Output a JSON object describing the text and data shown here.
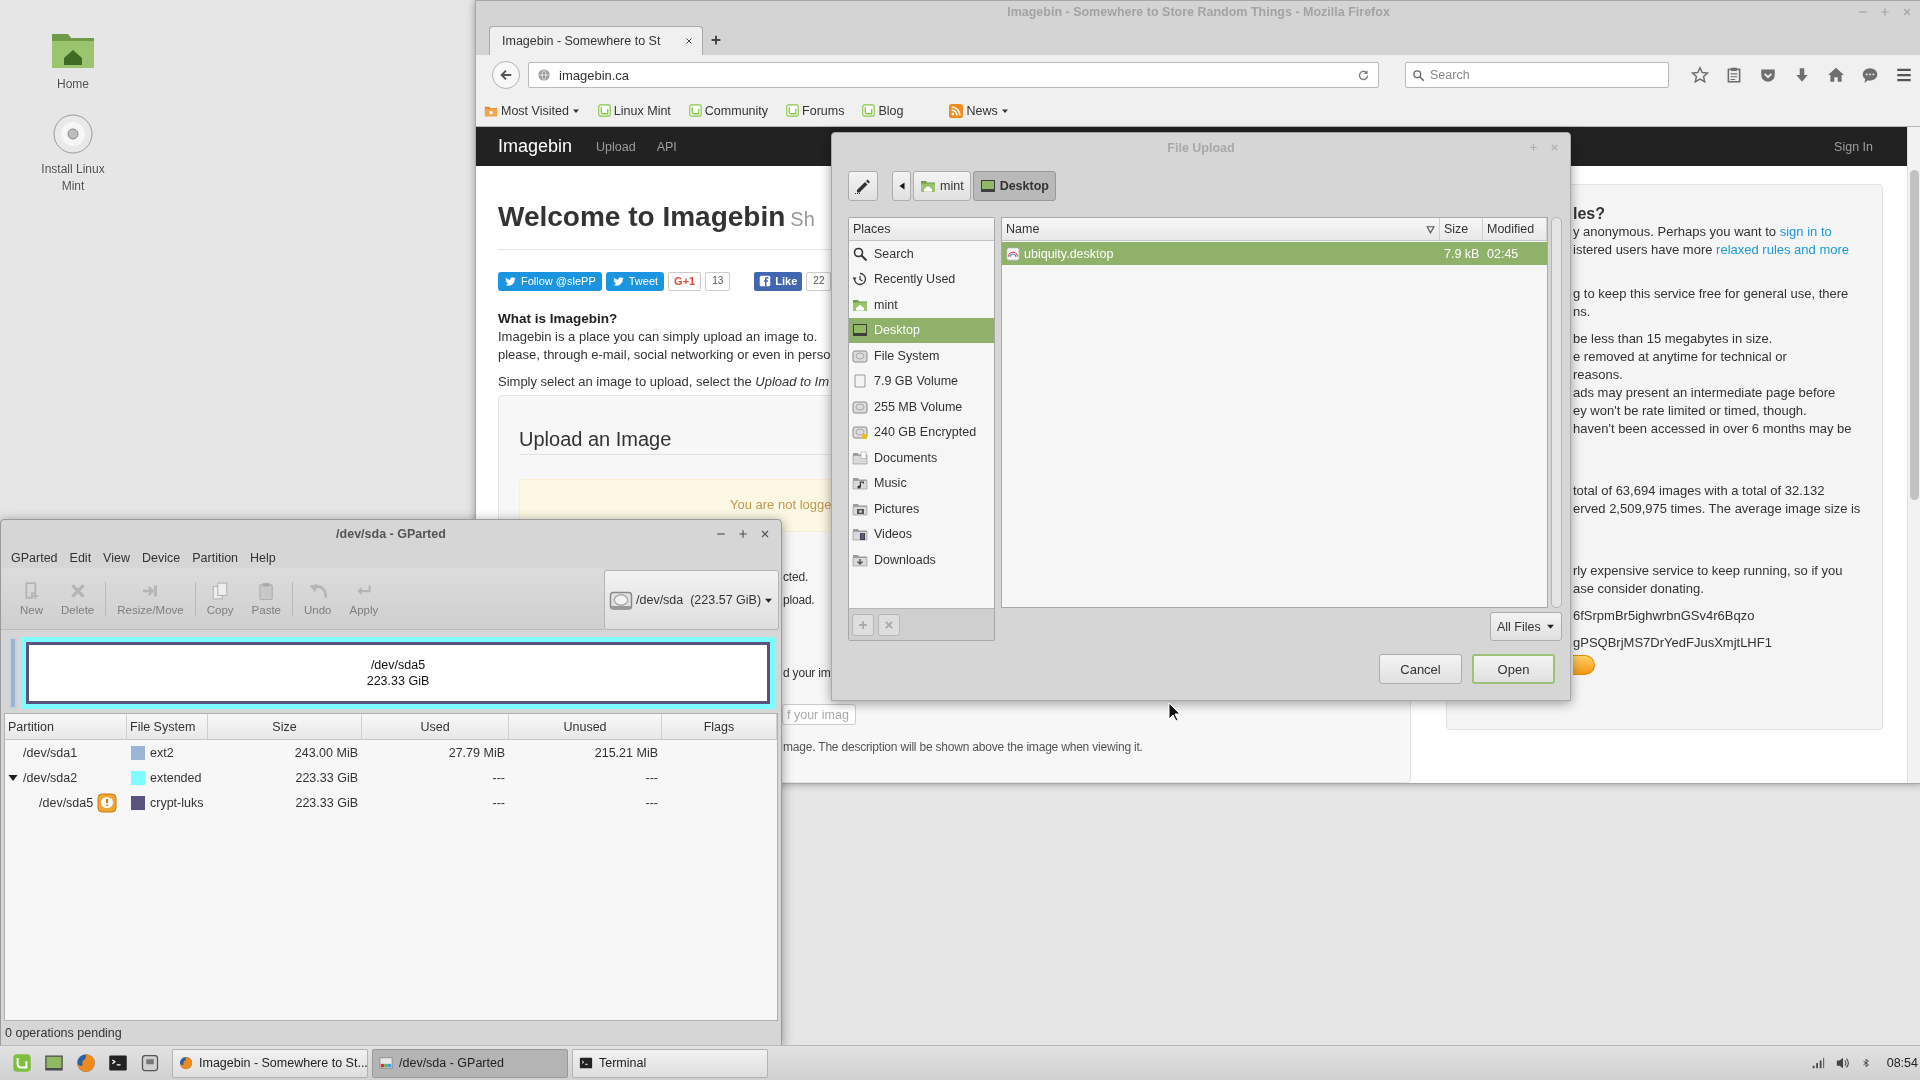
{
  "desktop": {
    "icons": [
      {
        "label": "Home",
        "kind": "home"
      },
      {
        "label": "Install Linux Mint",
        "kind": "disc"
      }
    ]
  },
  "firefox": {
    "title": "Imagebin - Somewhere to Store Random Things - Mozilla Firefox",
    "tabs": [
      {
        "label": "Imagebin - Somewhere to St",
        "selected": true
      }
    ],
    "url": "imagebin.ca",
    "search": {
      "placeholder": "Search"
    },
    "bookmarks": [
      {
        "label": "Most Visited",
        "kind": "folder",
        "menu": true
      },
      {
        "label": "Linux Mint",
        "kind": "site",
        "menu": false
      },
      {
        "label": "Community",
        "kind": "site",
        "menu": false
      },
      {
        "label": "Forums",
        "kind": "site",
        "menu": false
      },
      {
        "label": "Blog",
        "kind": "site",
        "menu": false
      },
      {
        "label": "News",
        "kind": "feed",
        "menu": true
      }
    ],
    "page": {
      "brand": "Imagebin",
      "nav_links": [
        "Upload",
        "API"
      ],
      "sign_in": "Sign In",
      "heading": "Welcome to Imagebin",
      "heading_small": "Sh",
      "social": [
        {
          "label": "Follow @slePP",
          "kind": "twitter"
        },
        {
          "label": "Tweet",
          "kind": "twitter"
        },
        {
          "label": "G+1",
          "kind": "gplus"
        },
        {
          "label": "13",
          "kind": "count"
        },
        {
          "label": "Like",
          "kind": "facebook"
        },
        {
          "label": "22",
          "kind": "count"
        }
      ],
      "intro_title": "What is Imagebin?",
      "intro": [
        "Imagebin is a place you can simply upload an image to.",
        "please, through e-mail, social networking or even in perso"
      ],
      "instruction": "Simply select an image to upload, select the *Upload to Im*",
      "upload": {
        "title": "Upload an Image",
        "alert": "You are not logge",
        "notes": [
          "cted.",
          "pload."
        ],
        "label": "d your im",
        "description": {
          "placeholder": "f your imag"
        },
        "help": "mage. The description will be shown above the image when viewing it."
      },
      "sidebar": [
        {
          "kind": "title",
          "lines": [
            [
              {
                "text": "les?",
                "link": false
              }
            ]
          ]
        },
        {
          "kind": "para",
          "lines": [
            [
              {
                "text": "y anonymous. Perhaps you want to ",
                "link": false
              },
              {
                "text": "sign in to",
                "link": true
              }
            ],
            [
              {
                "text": "istered users have more ",
                "link": false
              },
              {
                "text": "relaxed rules and more",
                "link": true
              }
            ]
          ]
        },
        {
          "kind": "para",
          "lines": [
            [
              {
                "text": "g to keep this service free for general use, there",
                "link": false
              }
            ],
            [
              {
                "text": "ns.",
                "link": false
              }
            ]
          ]
        },
        {
          "kind": "list",
          "lines": [
            [
              {
                "text": "be less than 15 megabytes in size.",
                "link": false
              }
            ],
            [
              {
                "text": "e removed at anytime for technical or",
                "link": false
              }
            ],
            [
              {
                "text": "reasons.",
                "link": false
              }
            ],
            [
              {
                "text": "ads may present an intermediate page before",
                "link": false
              }
            ],
            [
              {
                "text": "ey won't be rate limited or timed, though.",
                "link": false
              }
            ],
            [
              {
                "text": "haven't been accessed in over 6 months may be",
                "link": false
              }
            ]
          ]
        },
        {
          "kind": "section",
          "lines": [
            [
              {
                "text": "total of 63,694 images with a total of 32.132",
                "link": false
              }
            ],
            [
              {
                "text": "erved 2,509,975 times. The average image size is",
                "link": false
              }
            ]
          ]
        },
        {
          "kind": "section",
          "lines": [
            [
              {
                "text": "rly expensive service to keep running, so if you",
                "link": false
              }
            ],
            [
              {
                "text": "ase consider donating.",
                "link": false
              }
            ]
          ]
        },
        {
          "kind": "address",
          "lines": [
            [
              {
                "text": "6fSrpmBr5ighwrbnGSv4r6Bqzo",
                "link": false
              }
            ]
          ]
        },
        {
          "kind": "address",
          "lines": [
            [
              {
                "text": "gPSQBrjMS7DrYedFJusXmjtLHF1",
                "link": false
              }
            ]
          ]
        },
        {
          "kind": "donate"
        }
      ]
    }
  },
  "file_dialog": {
    "title": "File Upload",
    "path": [
      {
        "label": "mint",
        "kind": "home",
        "selected": false
      },
      {
        "label": "Desktop",
        "kind": "desktop",
        "selected": true
      }
    ],
    "places_title": "Places",
    "places": [
      {
        "label": "Search",
        "kind": "search",
        "selected": false
      },
      {
        "label": "Recently Used",
        "kind": "recent",
        "selected": false
      },
      {
        "label": "mint",
        "kind": "home",
        "selected": false
      },
      {
        "label": "Desktop",
        "kind": "desktop",
        "selected": true
      },
      {
        "label": "File System",
        "kind": "drive",
        "selected": false
      },
      {
        "label": "7.9 GB Volume",
        "kind": "volume",
        "selected": false
      },
      {
        "label": "255 MB Volume",
        "kind": "drive",
        "selected": false
      },
      {
        "label": "240 GB Encrypted",
        "kind": "encrypted",
        "selected": false
      },
      {
        "label": "Documents",
        "kind": "documents",
        "selected": false
      },
      {
        "label": "Music",
        "kind": "music",
        "selected": false
      },
      {
        "label": "Pictures",
        "kind": "pictures",
        "selected": false
      },
      {
        "label": "Videos",
        "kind": "videos",
        "selected": false
      },
      {
        "label": "Downloads",
        "kind": "downloads",
        "selected": false
      }
    ],
    "columns": [
      {
        "label": "Name",
        "sorted": true
      },
      {
        "label": "Size",
        "sorted": false
      },
      {
        "label": "Modified",
        "sorted": false
      }
    ],
    "files": [
      {
        "name": "ubiquity.desktop",
        "size": "7.9 kB",
        "modified": "02:45",
        "selected": true
      }
    ],
    "filter": "All Files",
    "buttons": [
      {
        "label": "Cancel",
        "default": false
      },
      {
        "label": "Open",
        "default": true
      }
    ]
  },
  "gparted": {
    "title": "/dev/sda - GParted",
    "menu": [
      "GParted",
      "Edit",
      "View",
      "Device",
      "Partition",
      "Help"
    ],
    "tools": [
      {
        "label": "New",
        "kind": "new",
        "disabled": true
      },
      {
        "label": "Delete",
        "kind": "delete",
        "disabled": true
      },
      {
        "kind": "separator"
      },
      {
        "label": "Resize/Move",
        "kind": "resize",
        "disabled": true
      },
      {
        "kind": "separator"
      },
      {
        "label": "Copy",
        "kind": "copy",
        "disabled": true
      },
      {
        "label": "Paste",
        "kind": "paste",
        "disabled": true
      },
      {
        "kind": "separator"
      },
      {
        "label": "Undo",
        "kind": "undo",
        "disabled": true
      },
      {
        "label": "Apply",
        "kind": "apply",
        "disabled": true
      }
    ],
    "device": {
      "label": "/dev/sda",
      "size": "(223.57 GiB)"
    },
    "map": {
      "label": "/dev/sda5",
      "size": "223.33 GiB"
    },
    "columns": [
      "Partition",
      "File System",
      "Size",
      "Used",
      "Unused",
      "Flags"
    ],
    "partitions": [
      {
        "name": "/dev/sda1",
        "fs": "ext2",
        "color": "#9db5d4",
        "size": "243.00 MiB",
        "used": "27.79 MiB",
        "unused": "215.21 MiB",
        "expanded": false,
        "warning": false
      },
      {
        "name": "/dev/sda2",
        "fs": "extended",
        "color": "#7dfdfd",
        "size": "223.33 GiB",
        "used": "---",
        "unused": "---",
        "expanded": true,
        "warning": false,
        "children": [
          {
            "name": "/dev/sda5",
            "fs": "crypt-luks",
            "color": "#5a5380",
            "size": "223.33 GiB",
            "used": "---",
            "unused": "---",
            "expanded": false,
            "warning": true
          }
        ]
      }
    ],
    "status": "0 operations pending"
  },
  "taskbar": {
    "launchers": [
      {
        "kind": "menu"
      },
      {
        "kind": "desktop"
      },
      {
        "kind": "browser"
      },
      {
        "kind": "terminal"
      },
      {
        "kind": "drive"
      }
    ],
    "tasks": [
      {
        "label": "Imagebin - Somewhere to St...",
        "kind": "browser",
        "selected": false
      },
      {
        "label": "/dev/sda - GParted",
        "kind": "gparted",
        "selected": true
      },
      {
        "label": "Terminal",
        "kind": "terminal",
        "selected": false
      }
    ],
    "tray": [
      {
        "kind": "signal"
      },
      {
        "kind": "volume"
      },
      {
        "kind": "bluetooth"
      }
    ],
    "clock": "08:54"
  }
}
